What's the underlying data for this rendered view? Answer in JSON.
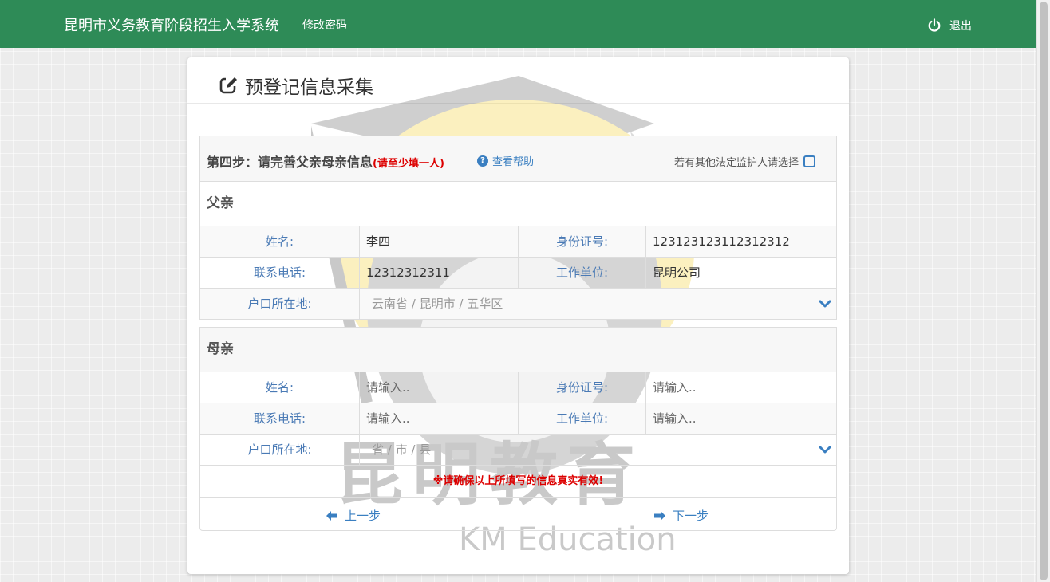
{
  "navbar": {
    "brand": "昆明市义务教育阶段招生入学系统",
    "change_password": "修改密码",
    "logout": "退出",
    "color": "#2e8b57"
  },
  "card": {
    "title": "预登记信息采集",
    "step_title": "第四步：请完善父亲母亲信息",
    "step_note": "(请至少填一人)",
    "help_link": "查看帮助",
    "guardian_option": "若有其他法定监护人请选择"
  },
  "watermark": {
    "text_cn": "昆明教育",
    "text_en": "KM Education"
  },
  "father": {
    "section_title": "父亲",
    "name_label": "姓名:",
    "name_value": "李四",
    "id_label": "身份证号:",
    "id_value": "123123123112312312",
    "phone_label": "联系电话:",
    "phone_value": "12312312311",
    "work_label": "工作单位:",
    "work_value": "昆明公司",
    "address_label": "户口所在地:",
    "address": {
      "province": "云南省",
      "city": "昆明市",
      "district": "五华区"
    }
  },
  "mother": {
    "section_title": "母亲",
    "name_label": "姓名:",
    "name_placeholder": "请输入..",
    "id_label": "身份证号:",
    "id_placeholder": "请输入..",
    "phone_label": "联系电话:",
    "phone_placeholder": "请输入..",
    "work_label": "工作单位:",
    "work_placeholder": "请输入..",
    "address_label": "户口所在地:",
    "address": {
      "province": "省",
      "city": "市",
      "district": "县"
    }
  },
  "notice": "※请确保以上所填写的信息真实有效!",
  "buttons": {
    "prev": "上一步",
    "next": "下一步"
  }
}
